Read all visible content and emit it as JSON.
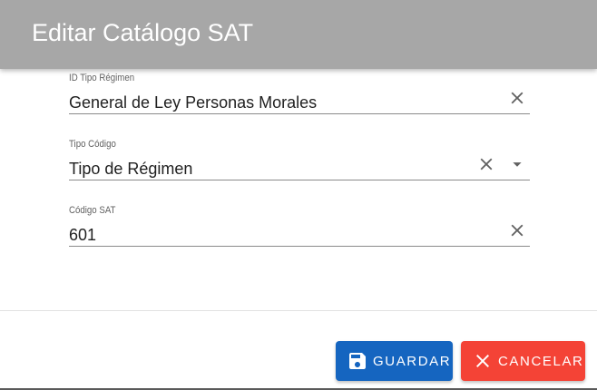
{
  "dialog": {
    "title": "Editar Catálogo SAT"
  },
  "fields": [
    {
      "label": "ID Tipo Régimen",
      "value": "General de Ley Personas Morales",
      "icons": [
        "close-icon"
      ]
    },
    {
      "label": "Tipo Código",
      "value": "Tipo de Régimen",
      "icons": [
        "close-icon",
        "caret-down-icon"
      ]
    },
    {
      "label": "Código SAT",
      "value": "601",
      "icons": [
        "close-icon"
      ]
    }
  ],
  "actions": {
    "save_label": "GUARDAR",
    "save_icon": "floppy-disk-icon",
    "cancel_label": "CANCELAR",
    "cancel_icon": "close-icon"
  },
  "colors": {
    "header_bg": "#a7a7a7",
    "save_bg": "#1565c0",
    "cancel_bg": "#f44336",
    "icon_gray": "#616161"
  }
}
